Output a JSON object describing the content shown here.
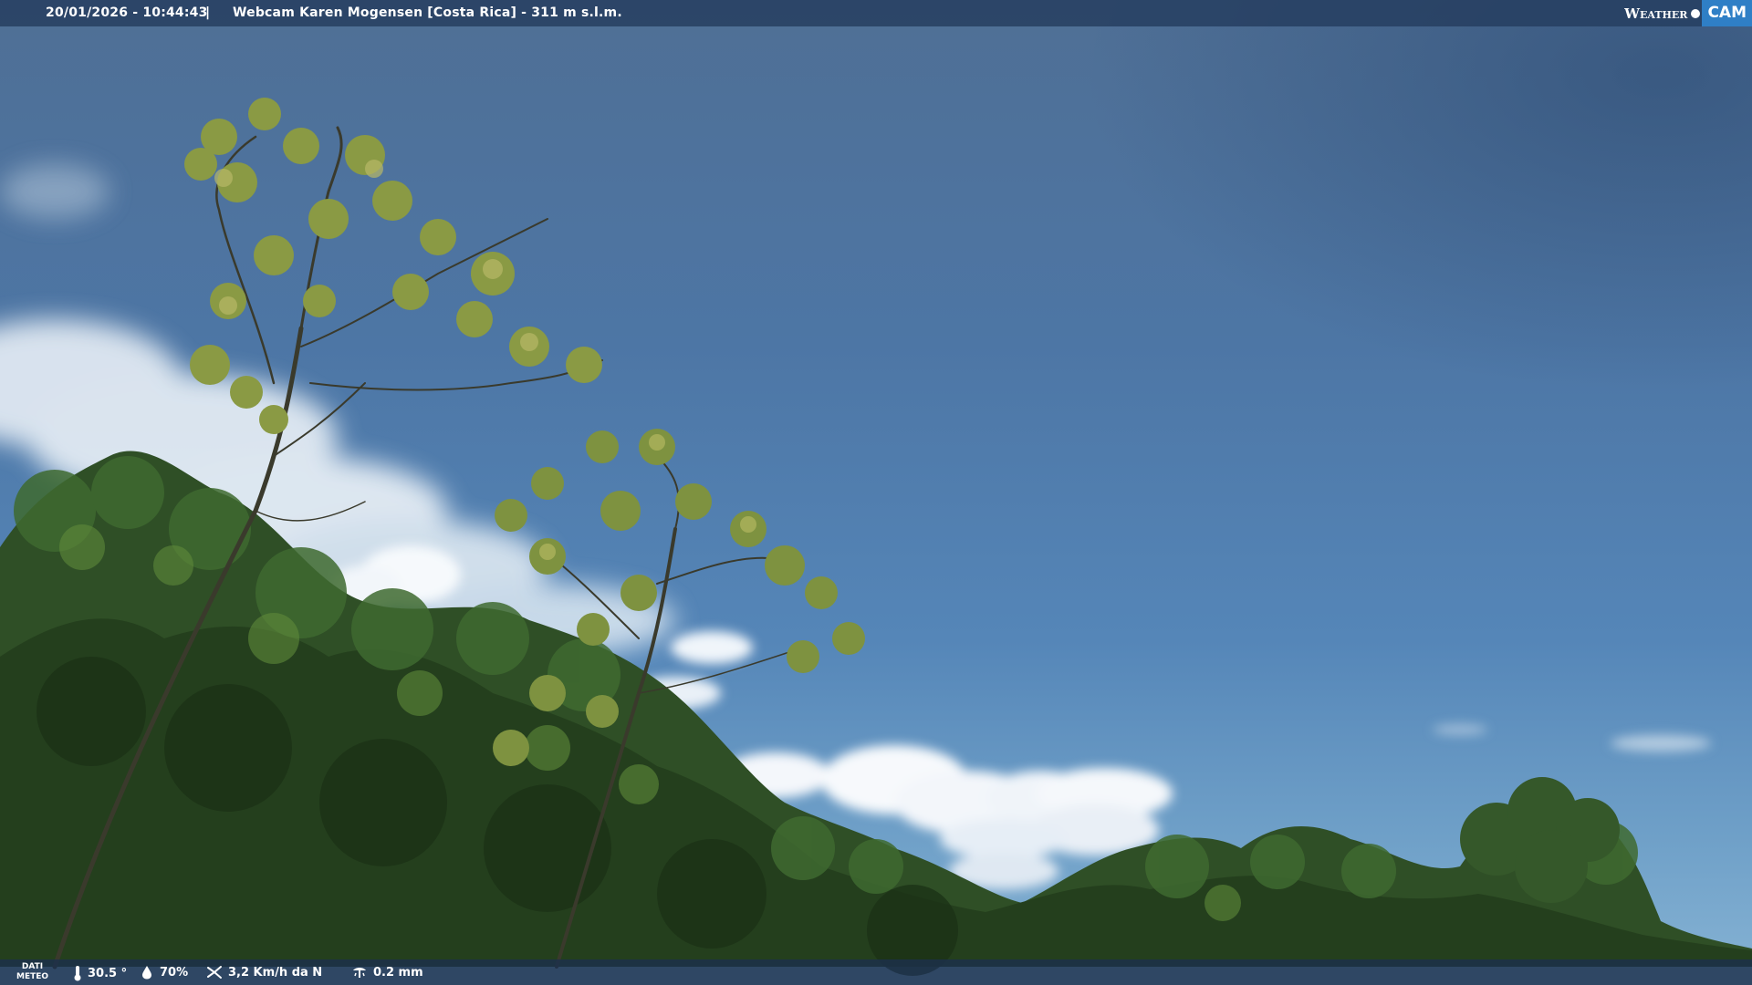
{
  "overlay": {
    "datetime": "20/01/2026 - 10:44:43",
    "separator": "|",
    "camera_title": "Webcam Karen Mogensen [Costa Rica] - 311 m s.l.m.",
    "logo": {
      "weather_text": "Weather",
      "cam_text": "CAM",
      "accent_color": "#2f7fc6"
    }
  },
  "weather": {
    "label_line1": "DATI",
    "label_line2": "METEO",
    "temperature": "30.5 °",
    "humidity": "70%",
    "wind": "3,2 Km/h da N",
    "rain": "0.2 mm",
    "icons": [
      "thermometer-icon",
      "humidity-drop-icon",
      "wind-icon",
      "rain-gauge-icon"
    ]
  }
}
